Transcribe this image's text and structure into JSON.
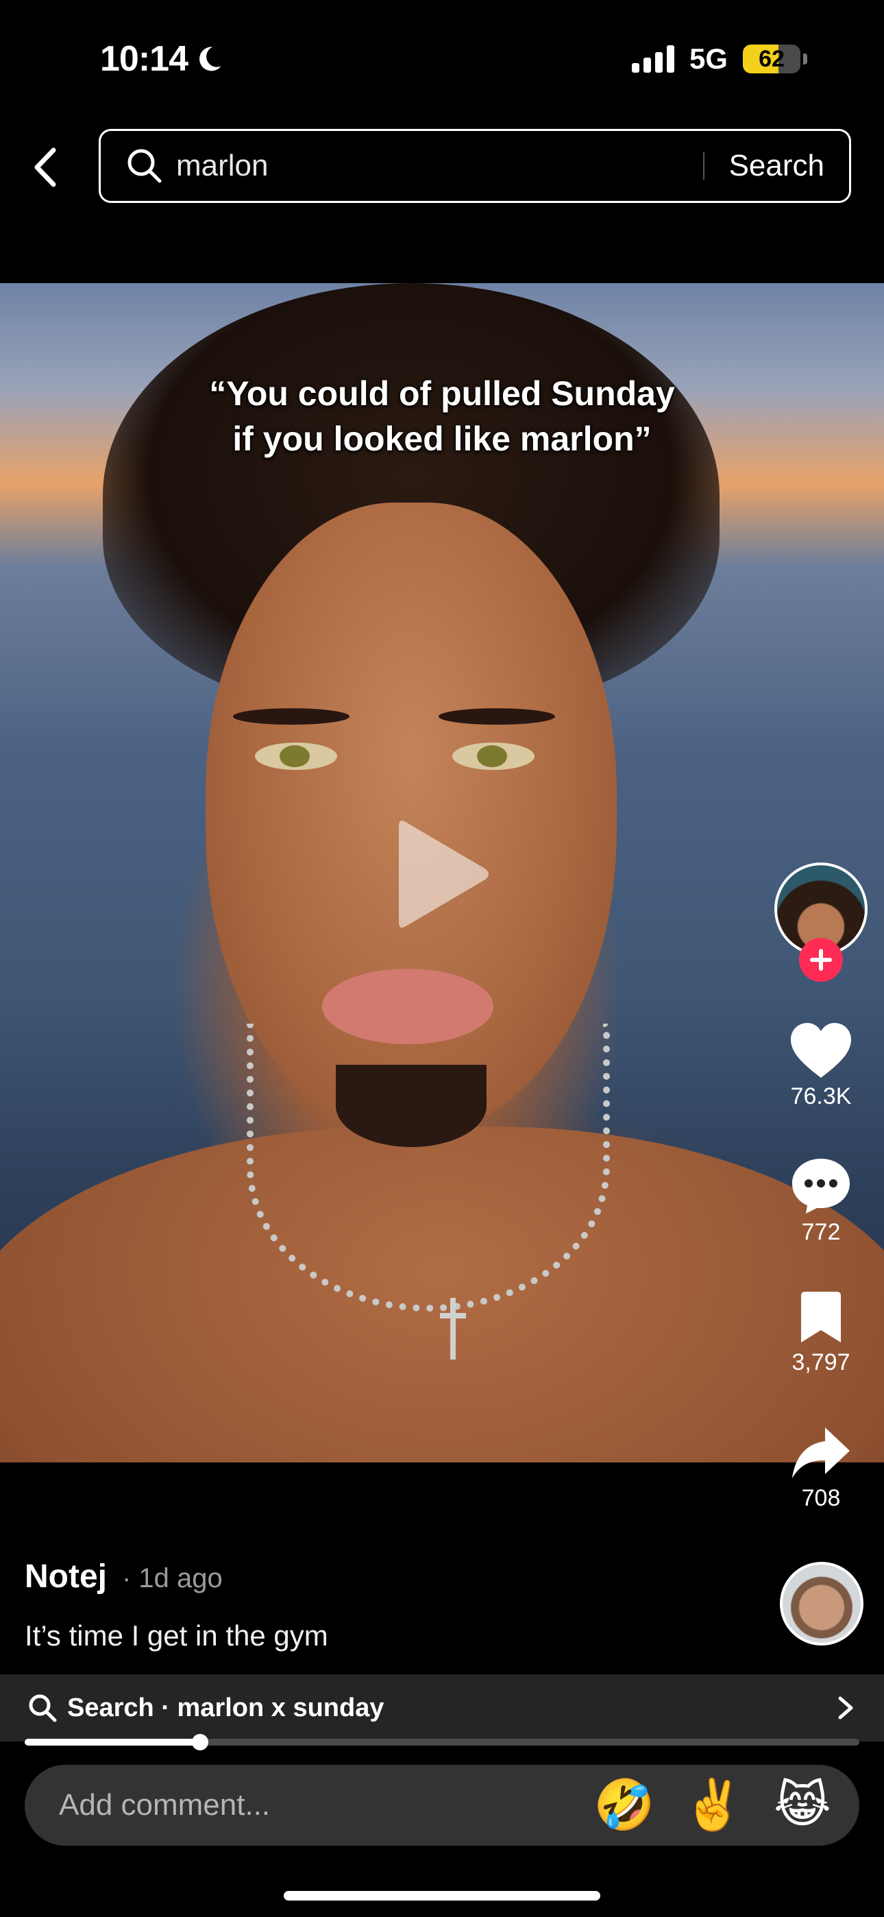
{
  "status_bar": {
    "time": "10:14",
    "network": "5G",
    "battery": "62",
    "battery_level": 0.62
  },
  "search": {
    "query": "marlon",
    "button_label": "Search"
  },
  "video": {
    "caption_line1": "“You could of pulled Sunday",
    "caption_line2": "if you looked like marlon”"
  },
  "actions": {
    "likes": "76.3K",
    "comments": "772",
    "saves": "3,797",
    "shares": "708"
  },
  "post": {
    "author": "Notej",
    "time_ago": "· 1d ago",
    "description": "It’s time I get in the gym"
  },
  "related_search": {
    "text": "Search · marlon x sunday"
  },
  "playback": {
    "progress": 0.21
  },
  "comment_input": {
    "placeholder": "Add comment...",
    "emojis": [
      "🤣",
      "✌️",
      "😹"
    ]
  },
  "colors": {
    "follow": "#fe2c55",
    "battery": "#f4d21c"
  }
}
